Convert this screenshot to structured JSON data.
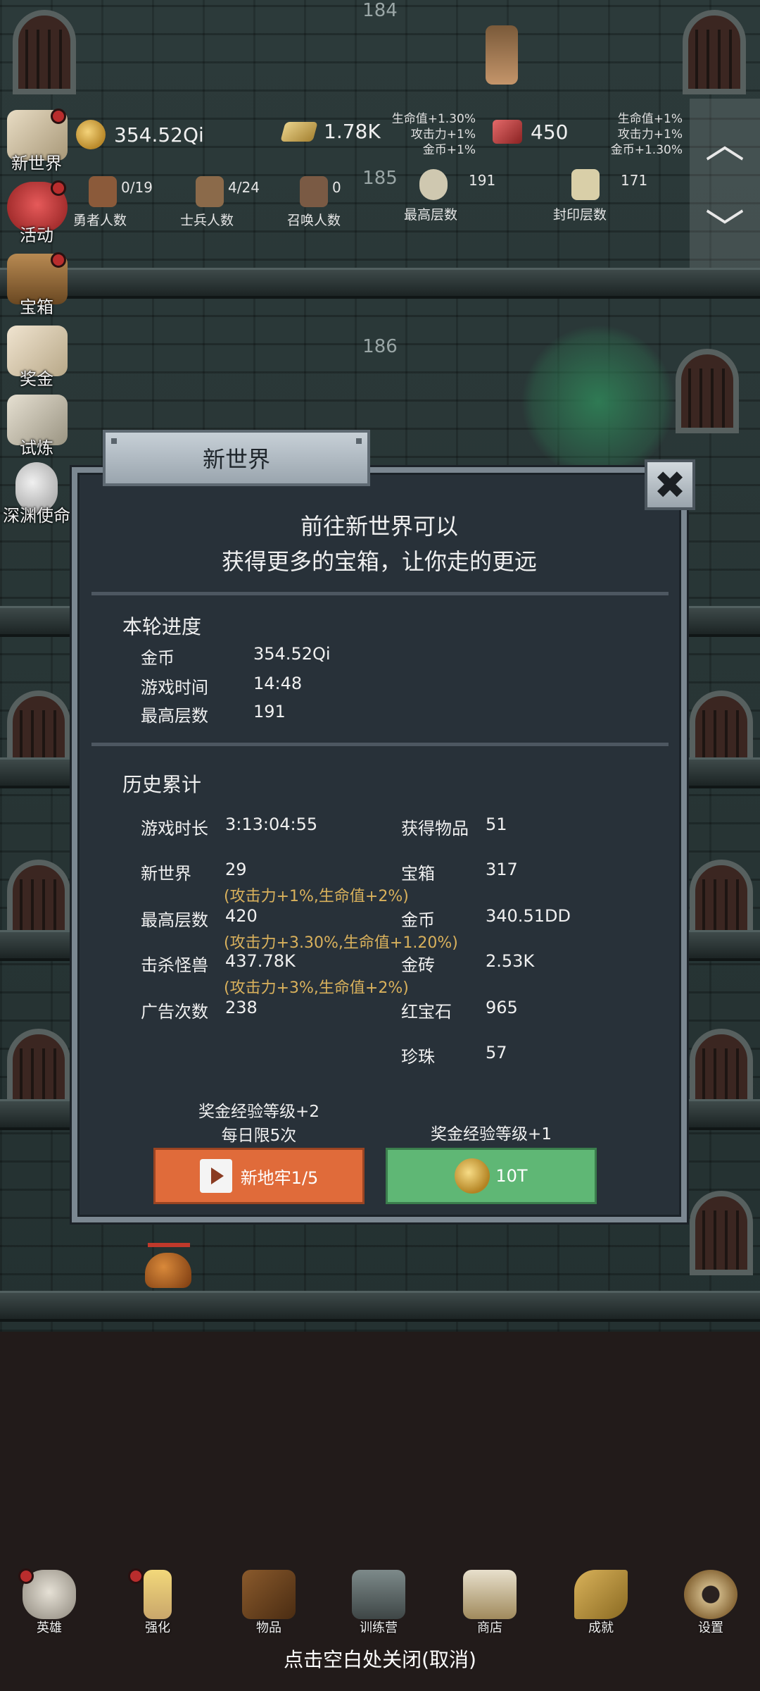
{
  "floors": [
    "184",
    "185",
    "186"
  ],
  "resources": {
    "gold": "354.52Qi",
    "gold_bar": "1.78K",
    "ruby": "450",
    "bonus_left": [
      "生命值+1.30%",
      "攻击力+1%",
      "金币+1%"
    ],
    "bonus_right": [
      "生命值+1%",
      "攻击力+1%",
      "金币+1.30%"
    ]
  },
  "stats": [
    {
      "value": "0/19",
      "label": "勇者人数"
    },
    {
      "value": "4/24",
      "label": "士兵人数"
    },
    {
      "value": "0",
      "label": "召唤人数"
    },
    {
      "value": "191",
      "label": "最高层数"
    },
    {
      "value": "171",
      "label": "封印层数"
    }
  ],
  "side_menu": [
    "新世界",
    "活动",
    "宝箱",
    "奖金",
    "试炼",
    "深渊使命"
  ],
  "dialog": {
    "title": "新世界",
    "close_symbol": "✖",
    "desc_line1": "前往新世界可以",
    "desc_line2": "获得更多的宝箱，让你走的更远",
    "round_title": "本轮进度",
    "round": [
      {
        "k": "金币",
        "v": "354.52Qi"
      },
      {
        "k": "游戏时间",
        "v": "14:48"
      },
      {
        "k": "最高层数",
        "v": "191"
      }
    ],
    "history_title": "历史累计",
    "history_left": [
      {
        "k": "游戏时长",
        "v": "3:13:04:55",
        "sub": ""
      },
      {
        "k": "新世界",
        "v": "29",
        "sub": "(攻击力+1%,生命值+2%)"
      },
      {
        "k": "最高层数",
        "v": "420",
        "sub": "(攻击力+3.30%,生命值+1.20%)"
      },
      {
        "k": "击杀怪兽",
        "v": "437.78K",
        "sub": "(攻击力+3%,生命值+2%)"
      },
      {
        "k": "广告次数",
        "v": "238",
        "sub": ""
      }
    ],
    "history_right": [
      {
        "k": "获得物品",
        "v": "51"
      },
      {
        "k": "宝箱",
        "v": "317"
      },
      {
        "k": "金币",
        "v": "340.51DD"
      },
      {
        "k": "金砖",
        "v": "2.53K"
      },
      {
        "k": "红宝石",
        "v": "965"
      },
      {
        "k": "珍珠",
        "v": "57"
      }
    ],
    "left_note1": "奖金经验等级+2",
    "left_note2": "每日限5次",
    "right_note": "奖金经验等级+1",
    "btn_dungeon": "新地牢1/5",
    "btn_coin": "10T"
  },
  "bottom_nav": [
    "英雄",
    "强化",
    "物品",
    "训练营",
    "商店",
    "成就",
    "设置"
  ],
  "close_hint": "点击空白处关闭(取消)",
  "colors": {
    "accent_orange": "#e06b3a",
    "accent_green": "#5fb775",
    "bonus_gold": "#d9b15c"
  }
}
